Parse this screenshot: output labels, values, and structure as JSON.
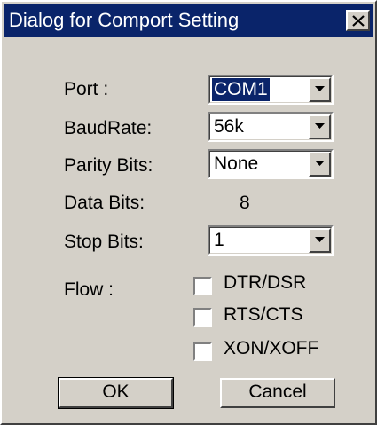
{
  "dialog": {
    "title": "Dialog for Comport Setting",
    "close_icon": "close-x-icon"
  },
  "fields": {
    "port": {
      "label": "Port :",
      "value": "COM1"
    },
    "baud_rate": {
      "label": "BaudRate:",
      "value": "56k"
    },
    "parity_bits": {
      "label": "Parity Bits:",
      "value": "None"
    },
    "data_bits": {
      "label": "Data Bits:",
      "value": "8"
    },
    "stop_bits": {
      "label": "Stop Bits:",
      "value": "1"
    }
  },
  "flow": {
    "label": "Flow :",
    "options": [
      {
        "label": "DTR/DSR",
        "checked": false
      },
      {
        "label": "RTS/CTS",
        "checked": false
      },
      {
        "label": "XON/XOFF",
        "checked": false
      }
    ]
  },
  "buttons": {
    "ok": "OK",
    "cancel": "Cancel"
  },
  "colors": {
    "titlebar": "#0a246a",
    "face": "#d4d0c8",
    "selection": "#0a246a"
  }
}
